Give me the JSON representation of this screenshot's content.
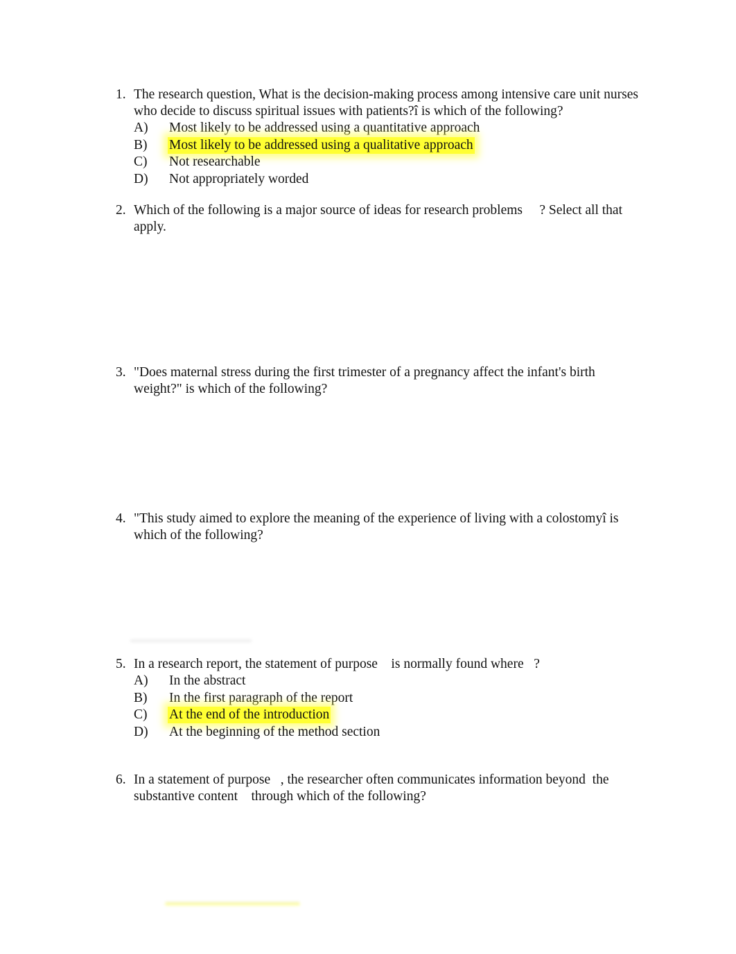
{
  "questions": [
    {
      "number": "1.",
      "text": "The research question, What is the decision-making process among intensive care unit nurses who decide to discuss spiritual issues with patients?î is which of the following?",
      "options": [
        {
          "letter": "A)",
          "text": "Most likely to be addressed using a quantitative approach",
          "highlighted": false
        },
        {
          "letter": "B)",
          "text": "Most likely to be addressed using a qualitative approach",
          "highlighted": true
        },
        {
          "letter": "C)",
          "text": "Not researchable",
          "highlighted": false
        },
        {
          "letter": "D)",
          "text": "Not appropriately worded",
          "highlighted": false
        }
      ]
    },
    {
      "number": "2.",
      "text": "Which of the following is a major source of ideas for research problems     ? Select all that apply."
    },
    {
      "number": "3.",
      "text": "\"Does maternal stress during the first trimester of a pregnancy affect the infant's birth weight?\" is which of the following?"
    },
    {
      "number": "4.",
      "text": "\"This study aimed to explore the meaning of the experience of living with a colostomyî is which of the following?"
    },
    {
      "number": "5.",
      "text": "In a research report, the statement of purpose    is normally found where   ?",
      "options": [
        {
          "letter": "A)",
          "text": "In the abstract",
          "highlighted": false
        },
        {
          "letter": "B)",
          "text": "In the first paragraph of the report",
          "highlighted": false
        },
        {
          "letter": "C)",
          "text": "At the end of the introduction",
          "highlighted": true
        },
        {
          "letter": "D)",
          "text": "At the beginning of the method section",
          "highlighted": false
        }
      ]
    },
    {
      "number": "6.",
      "text": "In a statement of purpose   , the researcher often communicates information beyond  the substantive content    through which of the following?"
    }
  ],
  "colors": {
    "highlight": "#ffff33",
    "text": "#111111"
  }
}
